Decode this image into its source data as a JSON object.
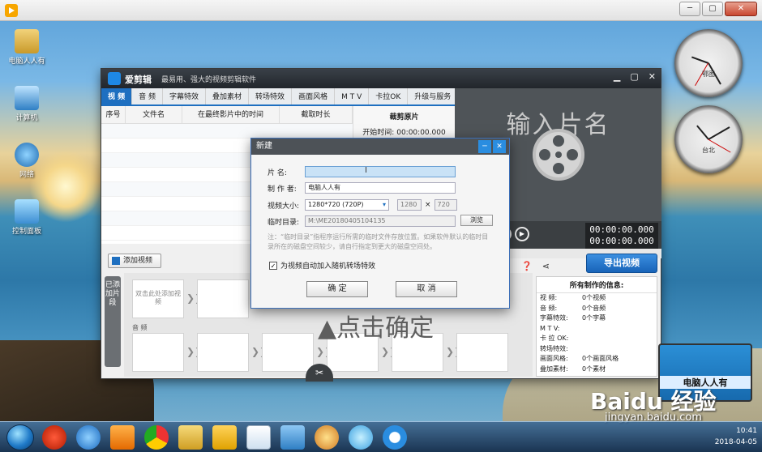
{
  "desktop": {
    "icons": [
      {
        "label": "电脑人人有"
      },
      {
        "label": "计算机"
      },
      {
        "label": "网络"
      },
      {
        "label": "控制面板"
      }
    ],
    "clock_labels": [
      "鄂图",
      "台北"
    ]
  },
  "app": {
    "name": "爱剪辑",
    "slogan": "最易用、强大的视频剪辑软件",
    "tabs": [
      "视 频",
      "音 频",
      "字幕特效",
      "叠加素材",
      "转场特效",
      "画面风格",
      "M T V",
      "卡拉OK",
      "升级与服务"
    ],
    "columns": [
      "序号",
      "文件名",
      "在最终影片中的时间",
      "截取时长"
    ],
    "crop": {
      "title": "裁剪原片",
      "start_label": "开始时间:",
      "start_value": "00:00:00.000"
    },
    "preview_title": "输入片名",
    "timecode_current": "00:00:00.000",
    "timecode_total": "00:00:00.000",
    "export_label": "导出视频",
    "add_video_label": "添加视频",
    "added_clips_label": "已添加片段",
    "timeline_hint": "双击此处添加视频",
    "audio_label": "音 频",
    "info": {
      "title": "所有制作的信息:",
      "rows": [
        {
          "k": "视 频:",
          "v": "0个视频"
        },
        {
          "k": "音 频:",
          "v": "0个音频"
        },
        {
          "k": "字幕特效:",
          "v": "0个字幕"
        },
        {
          "k": "M T V:",
          "v": ""
        },
        {
          "k": "卡 拉 OK:",
          "v": ""
        },
        {
          "k": "转场特效:",
          "v": ""
        },
        {
          "k": "画面风格:",
          "v": "0个画面风格"
        },
        {
          "k": "叠加素材:",
          "v": "0个素材"
        }
      ]
    }
  },
  "dialog": {
    "title": "新建",
    "name_label": "片 名:",
    "name_value": "",
    "author_label": "制 作 者:",
    "author_value": "电脑人人有",
    "size_label": "视频大小:",
    "size_value": "1280*720 (720P)",
    "width_value": "1280",
    "times": "×",
    "height_value": "720",
    "temp_label": "临时目录:",
    "temp_value": "M:\\ME20180405104135",
    "browse_label": "浏览",
    "note": "注：“临时目录”指程序运行所需的临时文件存放位置。如果软件默认的临时目录所在的磁盘空间较少，请自行指定到更大的磁盘空间处。",
    "checkbox_label": "为视频自动加入随机转场特效",
    "ok_label": "确 定",
    "cancel_label": "取 消"
  },
  "annotation": "▲点击确定",
  "watermark": {
    "logo_text": "电脑人人有",
    "brand": "Baidu 经验",
    "url": "jingyan.baidu.com"
  },
  "taskbar": {
    "time": "10:41",
    "date": "2018-04-05"
  }
}
